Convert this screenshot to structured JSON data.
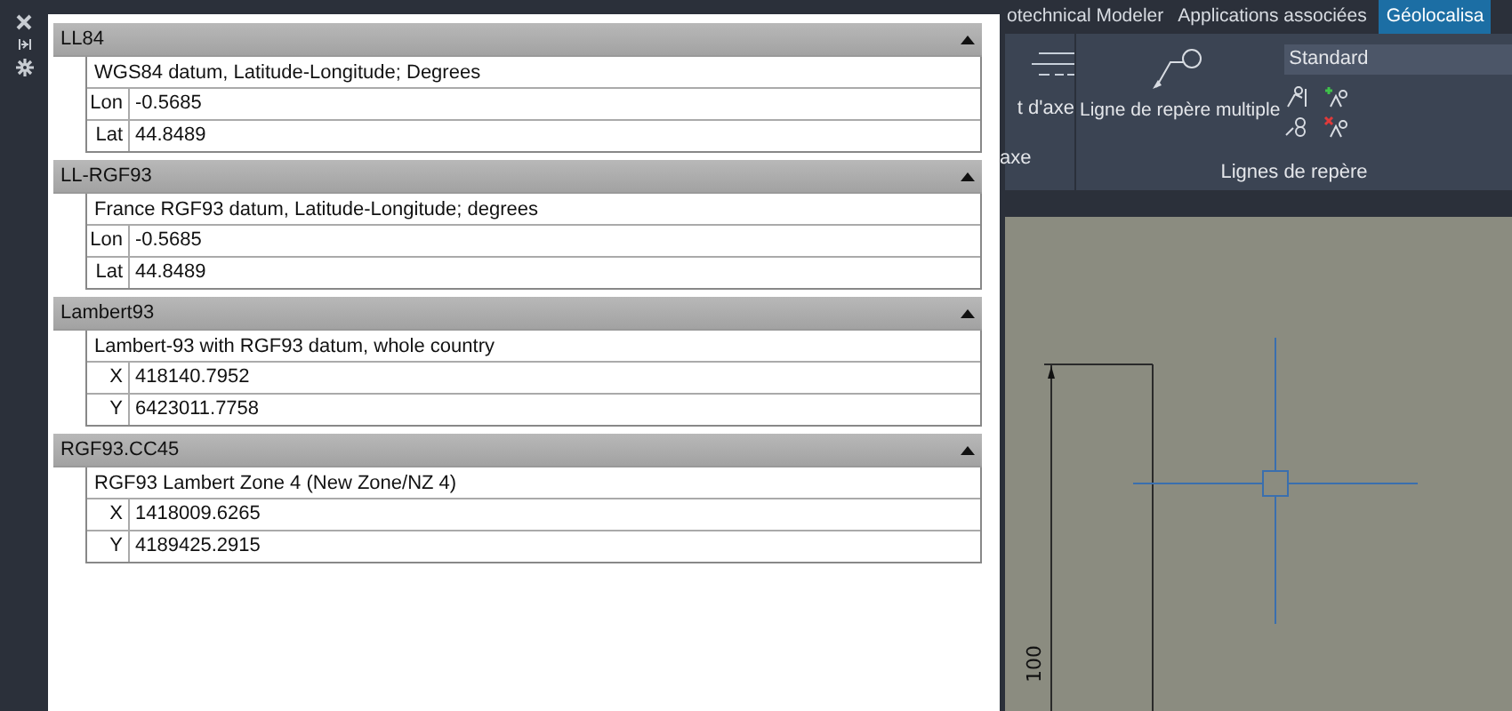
{
  "systems": [
    {
      "name": "LL84",
      "expanded": true,
      "description": "WGS84 datum, Latitude-Longitude; Degrees",
      "rows": [
        {
          "label": "Lon",
          "value": "-0.5685"
        },
        {
          "label": "Lat",
          "value": "44.8489"
        }
      ]
    },
    {
      "name": "LL-RGF93",
      "expanded": true,
      "description": "France RGF93 datum, Latitude-Longitude; degrees",
      "rows": [
        {
          "label": "Lon",
          "value": "-0.5685"
        },
        {
          "label": "Lat",
          "value": "44.8489"
        }
      ]
    },
    {
      "name": "Lambert93",
      "expanded": true,
      "description": "Lambert-93 with RGF93 datum, whole country",
      "rows": [
        {
          "label": "X",
          "value": "418140.7952"
        },
        {
          "label": "Y",
          "value": "6423011.7758"
        }
      ]
    },
    {
      "name": "RGF93.CC45",
      "expanded": true,
      "description": "RGF93 Lambert Zone 4 (New Zone/NZ 4)",
      "rows": [
        {
          "label": "X",
          "value": "1418009.6265"
        },
        {
          "label": "Y",
          "value": "4189425.2915"
        }
      ]
    }
  ],
  "ribbon": {
    "tabs": [
      {
        "label": "otechnical Modeler",
        "selected": false
      },
      {
        "label": "Applications associées",
        "selected": false
      },
      {
        "label": "Géolocalisa",
        "selected": true
      }
    ],
    "axis_button": "t d'axe",
    "axis_panel_title": "axe",
    "multileader_button": "Ligne de repère multiple",
    "style_dropdown": {
      "value": "Standard"
    },
    "leaders_panel_title": "Lignes de repère"
  },
  "canvas": {
    "dimension": "100"
  }
}
